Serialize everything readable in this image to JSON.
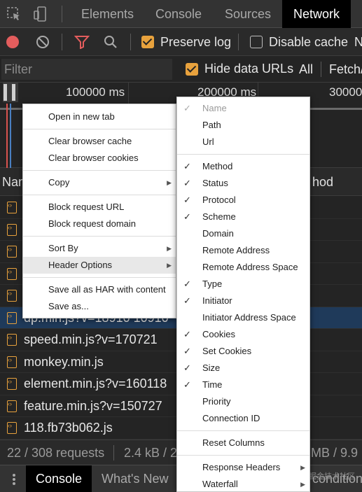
{
  "tabs": {
    "elements": "Elements",
    "console": "Console",
    "sources": "Sources",
    "network": "Network"
  },
  "toolbar": {
    "preserve_log": "Preserve log",
    "disable_cache": "Disable cache",
    "overflow": "N"
  },
  "filter": {
    "placeholder": "Filter",
    "hide_data_urls": "Hide data URLs",
    "all": "All",
    "fetch": "Fetch/"
  },
  "overview": {
    "ticks": [
      "100000 ms",
      "200000 ms",
      "30000"
    ]
  },
  "table": {
    "col_name": "Nam",
    "col_method": "hod",
    "rows": [
      {
        "name": ""
      },
      {
        "name": ""
      },
      {
        "name": ""
      },
      {
        "name": ""
      },
      {
        "name": ""
      },
      {
        "name": "dp.min.js?v=18910 10910"
      },
      {
        "name": "speed.min.js?v=170721"
      },
      {
        "name": "monkey.min.js"
      },
      {
        "name": "element.min.js?v=160118"
      },
      {
        "name": "feature.min.js?v=150727"
      },
      {
        "name": "118.fb73b062.js"
      }
    ]
  },
  "status": {
    "requests": "22 / 308 requests",
    "transferred": "2.4 kB / 2",
    "resources": "MB / 9.9"
  },
  "drawer": {
    "console": "Console",
    "whats_new": "What's New",
    "conditions": "condition"
  },
  "context_menu": {
    "open_new_tab": "Open in new tab",
    "clear_cache": "Clear browser cache",
    "clear_cookies": "Clear browser cookies",
    "copy": "Copy",
    "block_url": "Block request URL",
    "block_domain": "Block request domain",
    "sort_by": "Sort By",
    "header_options": "Header Options",
    "save_har": "Save all as HAR with content",
    "save_as": "Save as..."
  },
  "header_submenu": {
    "items": [
      {
        "label": "Name",
        "checked": true,
        "disabled": true
      },
      {
        "label": "Path",
        "checked": false
      },
      {
        "label": "Url",
        "checked": false
      },
      {
        "label": "Method",
        "checked": true
      },
      {
        "label": "Status",
        "checked": true
      },
      {
        "label": "Protocol",
        "checked": true
      },
      {
        "label": "Scheme",
        "checked": true
      },
      {
        "label": "Domain",
        "checked": false
      },
      {
        "label": "Remote Address",
        "checked": false
      },
      {
        "label": "Remote Address Space",
        "checked": false
      },
      {
        "label": "Type",
        "checked": true
      },
      {
        "label": "Initiator",
        "checked": true
      },
      {
        "label": "Initiator Address Space",
        "checked": false
      },
      {
        "label": "Cookies",
        "checked": true
      },
      {
        "label": "Set Cookies",
        "checked": true
      },
      {
        "label": "Size",
        "checked": true
      },
      {
        "label": "Time",
        "checked": true
      },
      {
        "label": "Priority",
        "checked": false
      },
      {
        "label": "Connection ID",
        "checked": false
      },
      {
        "label": "Reset Columns",
        "checked": false
      },
      {
        "label": "Response Headers",
        "checked": false,
        "submenu": true
      },
      {
        "label": "Waterfall",
        "checked": false,
        "submenu": true
      }
    ]
  },
  "watermark": "@稀土掘金技术社区",
  "colors": {
    "accent": "#e8a23d",
    "record": "#e35d5d",
    "selected_row": "#1f3a5a"
  }
}
